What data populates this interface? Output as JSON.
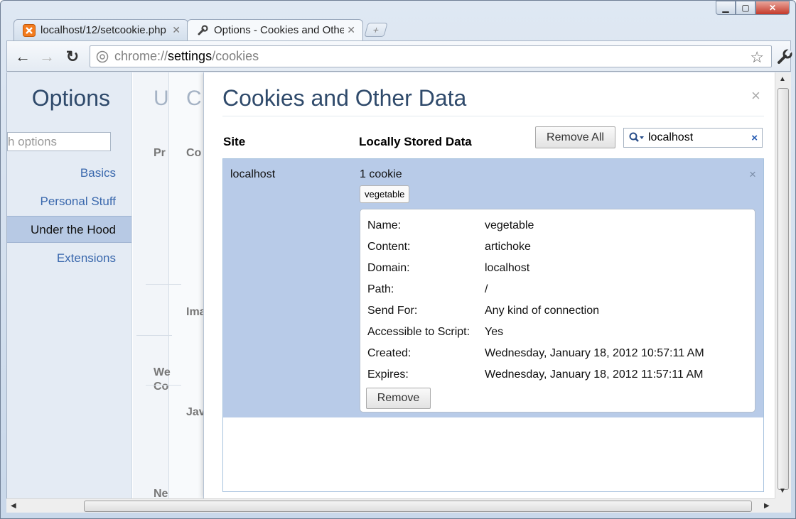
{
  "window": {
    "controls": {
      "minimize": "▁",
      "maximize": "▢",
      "close": "✕"
    }
  },
  "tabs": [
    {
      "label": "localhost/12/setcookie.php",
      "icon": "xampp-icon",
      "active": false
    },
    {
      "label": "Options - Cookies and Other Data",
      "icon": "wrench-icon",
      "active": true
    }
  ],
  "toolbar": {
    "back": "←",
    "forward": "→",
    "reload": "↻",
    "url_scheme": "chrome://",
    "url_host": "settings",
    "url_path": "/cookies",
    "star": "☆"
  },
  "sidebar": {
    "title": "Options",
    "search_value": "h options",
    "items": [
      {
        "label": "Basics",
        "selected": false
      },
      {
        "label": "Personal Stuff",
        "selected": false
      },
      {
        "label": "Under the Hood",
        "selected": true
      },
      {
        "label": "Extensions",
        "selected": false
      }
    ]
  },
  "background_page": {
    "big1": "U",
    "big2": "C",
    "labels": [
      "Pr",
      "Co",
      "Ima",
      "We",
      "Co",
      "Jav",
      "Ne"
    ]
  },
  "overlay": {
    "title": "Cookies and Other Data",
    "close": "×",
    "col_site": "Site",
    "col_data": "Locally Stored Data",
    "remove_all": "Remove All",
    "search_value": "localhost",
    "search_clear": "×",
    "row": {
      "site": "localhost",
      "count": "1 cookie",
      "close": "×",
      "chip": "vegetable",
      "details": [
        {
          "key": "Name:",
          "value": "vegetable"
        },
        {
          "key": "Content:",
          "value": "artichoke"
        },
        {
          "key": "Domain:",
          "value": "localhost"
        },
        {
          "key": "Path:",
          "value": "/"
        },
        {
          "key": "Send For:",
          "value": "Any kind of connection"
        },
        {
          "key": "Accessible to Script:",
          "value": "Yes"
        },
        {
          "key": "Created:",
          "value": "Wednesday, January 18, 2012 10:57:11 AM"
        },
        {
          "key": "Expires:",
          "value": "Wednesday, January 18, 2012 11:57:11 AM"
        }
      ],
      "remove": "Remove"
    }
  },
  "colors": {
    "accent": "#3a68ad",
    "title": "#2f4a6b",
    "selection": "#b8cbe8"
  }
}
